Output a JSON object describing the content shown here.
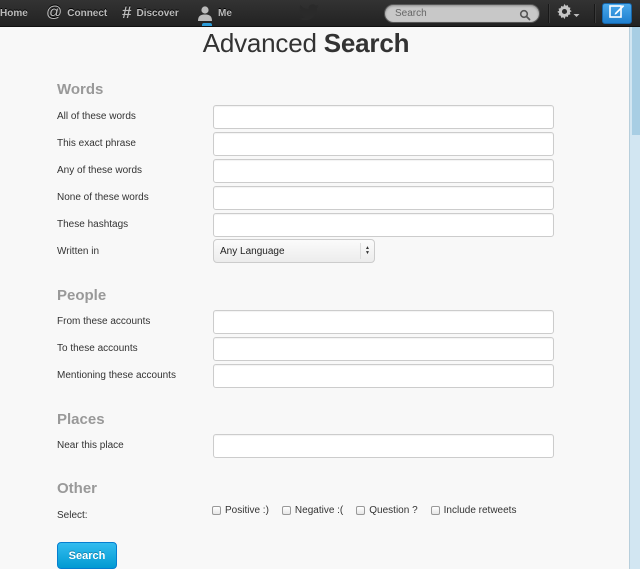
{
  "navbar": {
    "home": "Home",
    "connect": "Connect",
    "discover": "Discover",
    "me": "Me",
    "search_placeholder": "Search",
    "icons": {
      "connect": "at-icon",
      "discover": "hashtag-icon",
      "me": "person-icon",
      "logo": "bird-icon",
      "search": "magnifier-icon",
      "settings": "gear-icon",
      "compose": "compose-icon"
    },
    "connect_glyph": "@",
    "discover_glyph": "#"
  },
  "page": {
    "title_light": "Advanced ",
    "title_bold": "Search"
  },
  "sections": {
    "words": {
      "title": "Words",
      "fields": [
        {
          "label": "All of these words",
          "value": ""
        },
        {
          "label": "This exact phrase",
          "value": ""
        },
        {
          "label": "Any of these words",
          "value": ""
        },
        {
          "label": "None of these words",
          "value": ""
        },
        {
          "label": "These hashtags",
          "value": ""
        }
      ],
      "language_label": "Written in",
      "language_value": "Any Language"
    },
    "people": {
      "title": "People",
      "fields": [
        {
          "label": "From these accounts",
          "value": ""
        },
        {
          "label": "To these accounts",
          "value": ""
        },
        {
          "label": "Mentioning these accounts",
          "value": ""
        }
      ]
    },
    "places": {
      "title": "Places",
      "fields": [
        {
          "label": "Near this place",
          "value": ""
        }
      ]
    },
    "other": {
      "title": "Other",
      "select_label": "Select:",
      "options": [
        {
          "label": "Positive :)",
          "checked": false
        },
        {
          "label": "Negative :(",
          "checked": false
        },
        {
          "label": "Question ?",
          "checked": false
        },
        {
          "label": "Include retweets",
          "checked": false
        }
      ]
    }
  },
  "actions": {
    "search_label": "Search"
  },
  "colors": {
    "accent": "#019ad2",
    "compose": "#1e7fcf",
    "section_title": "#999999"
  }
}
